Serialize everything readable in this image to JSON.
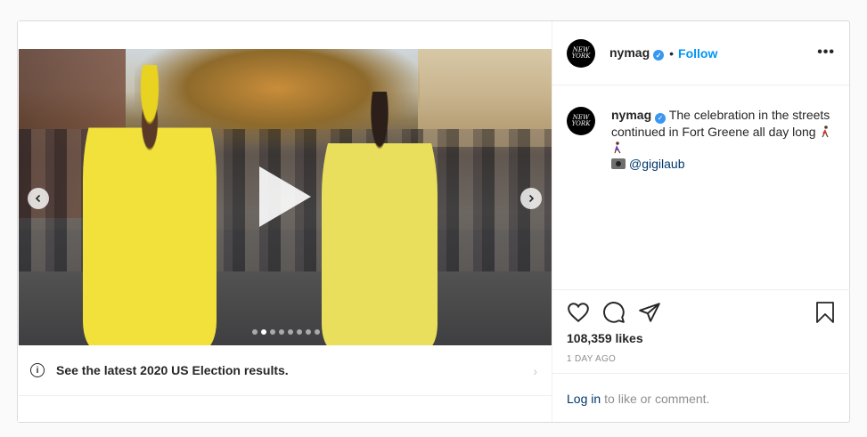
{
  "post": {
    "username": "nymag",
    "verified_mark": "✓",
    "follow_separator": "•",
    "follow_label": "Follow",
    "more_label": "•••",
    "avatar_text": "NEW YORK",
    "caption": {
      "username": "nymag",
      "text": "The celebration in the streets continued in Fort Greene all day long",
      "mention": "@gigilaub"
    },
    "carousel": {
      "slides": 8,
      "active_index": 1
    },
    "election_banner": "See the latest 2020 US Election results.",
    "info_glyph": "i",
    "chevron_glyph": "›",
    "likes": "108,359 likes",
    "time_ago": "1 DAY AGO",
    "login_link": "Log in",
    "login_rest": "to like or comment."
  },
  "icons": [
    "heart-icon",
    "comment-icon",
    "share-icon",
    "bookmark-icon",
    "play-icon",
    "chevron-left-icon",
    "chevron-right-icon",
    "info-icon",
    "camera-icon",
    "dancer-icon"
  ],
  "colors": {
    "accent": "#0095f6",
    "verified": "#3897f0",
    "link": "#00376b",
    "muted": "#8e8e8e"
  }
}
